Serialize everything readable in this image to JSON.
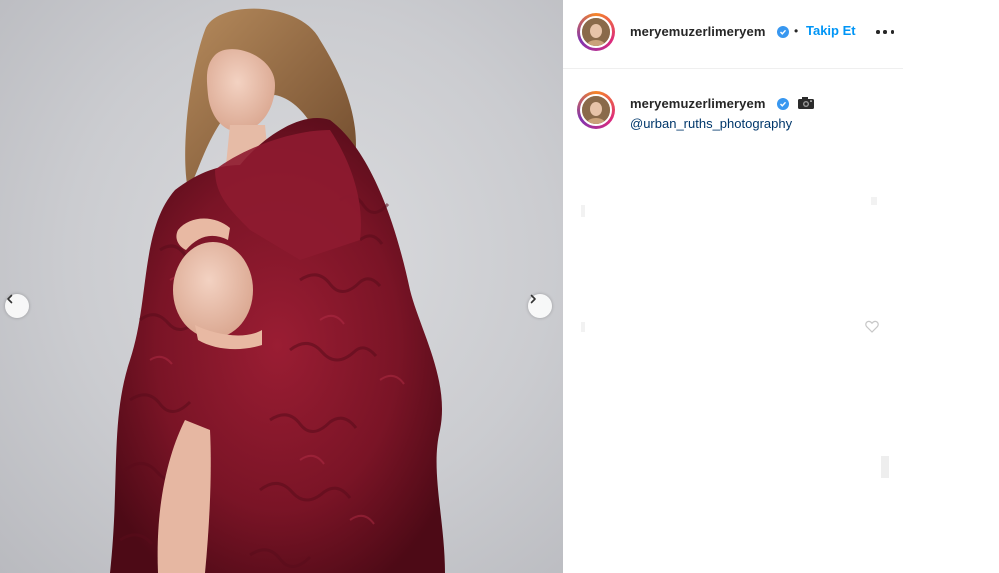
{
  "post": {
    "username": "meryemuzerlimeryem",
    "follow_label": "Takip Et",
    "separator": "•"
  },
  "caption": {
    "username": "meryemuzerlimeryem",
    "camera_icon": "camera-icon",
    "mention": "@urban_ruths_photography"
  },
  "colors": {
    "accent": "#0095f6",
    "verified": "#3897f0",
    "dress": "#7a1426",
    "background": "#cbccd0"
  },
  "icons": {
    "prev": "chevron-left-icon",
    "next": "chevron-right-icon",
    "more": "more-options-icon",
    "verified": "verified-badge-icon"
  }
}
